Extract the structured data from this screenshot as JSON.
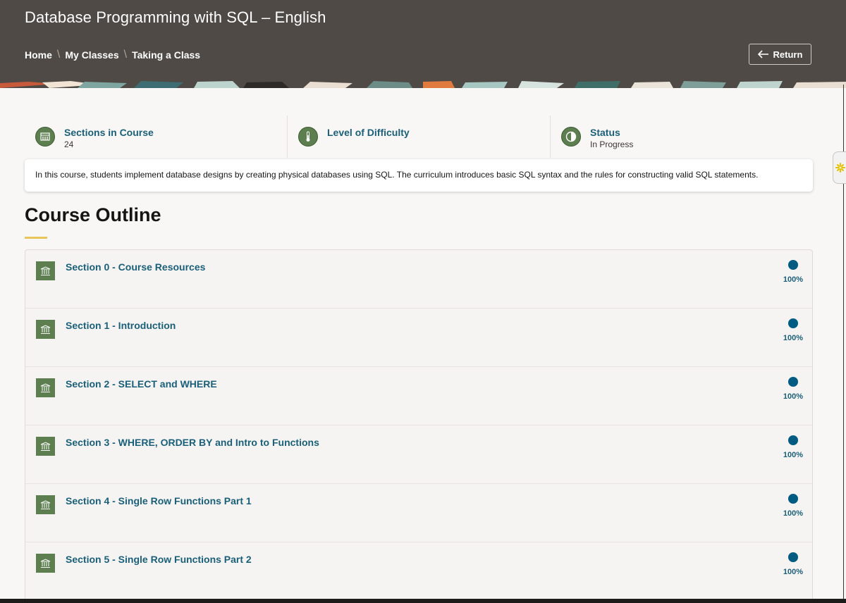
{
  "header": {
    "title": "Database Programming with SQL – English",
    "breadcrumb": [
      "Home",
      "My Classes",
      "Taking a Class"
    ],
    "return_label": "Return",
    "background": "#4f4a46"
  },
  "stats": [
    {
      "label": "Sections in Course",
      "value": "24",
      "icon": "calendar-icon"
    },
    {
      "label": "Level of Difficulty",
      "value": "",
      "icon": "thermometer-icon"
    },
    {
      "label": "Status",
      "value": "In Progress",
      "icon": "half-circle-icon"
    }
  ],
  "description": "In this course, students implement database designs by creating physical databases using SQL. The curriculum introduces basic SQL syntax and the rules for constructing valid SQL statements.",
  "outline": {
    "title": "Course Outline",
    "sections": [
      {
        "title": "Section 0 - Course Resources",
        "progress": "100%"
      },
      {
        "title": "Section 1 - Introduction",
        "progress": "100%"
      },
      {
        "title": "Section 2 - SELECT and WHERE",
        "progress": "100%"
      },
      {
        "title": "Section 3 - WHERE, ORDER BY and Intro to Functions",
        "progress": "100%"
      },
      {
        "title": "Section 4 - Single Row Functions Part 1",
        "progress": "100%"
      },
      {
        "title": "Section 5 - Single Row Functions Part 2",
        "progress": "100%"
      }
    ]
  },
  "colors": {
    "accent_link": "#1a5f7a",
    "icon_green": "#5d7f4f",
    "progress_blue": "#005b82",
    "underline_gold": "#e8c65a"
  }
}
